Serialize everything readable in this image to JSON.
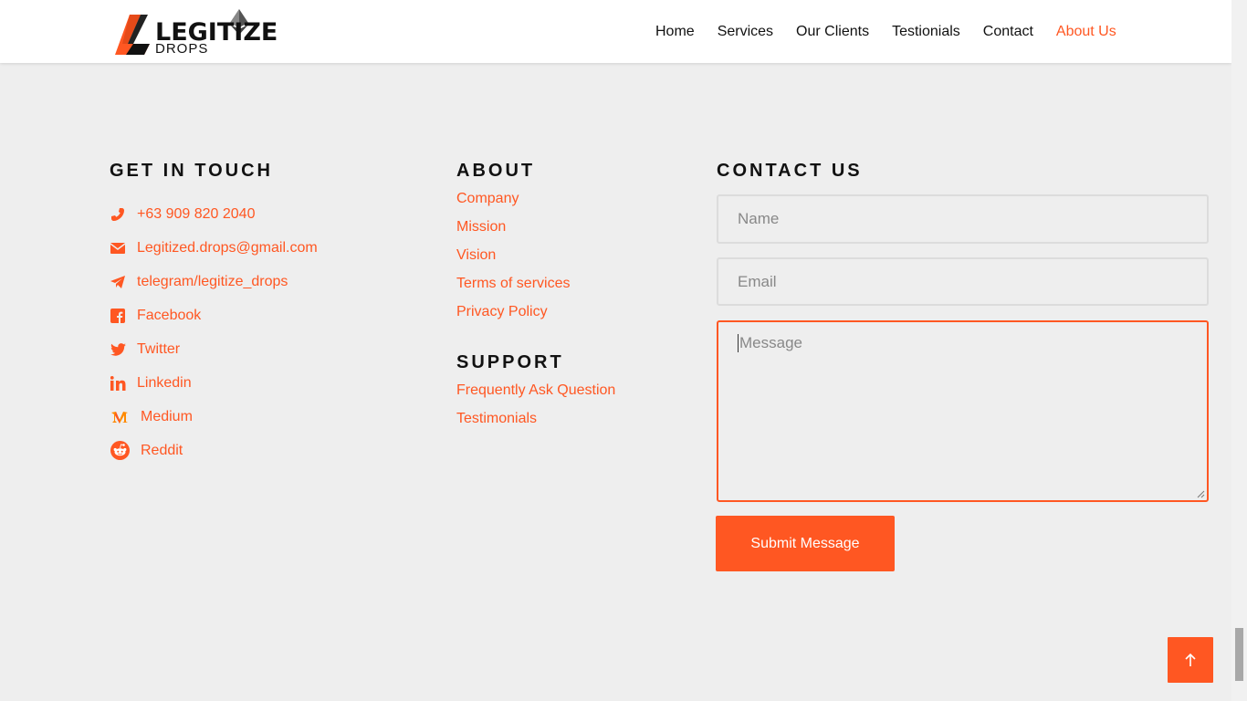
{
  "brand": {
    "word": "LEGITIZE",
    "sub": "DROPS"
  },
  "nav": {
    "items": [
      "Home",
      "Services",
      "Our Clients",
      "Testionials",
      "Contact",
      "About Us"
    ],
    "active": "About Us"
  },
  "get_in_touch": {
    "title": "GET IN TOUCH",
    "items": [
      {
        "icon": "phone-icon",
        "label": "+63 909 820 2040"
      },
      {
        "icon": "envelope-icon",
        "label": "Legitized.drops@gmail.com"
      },
      {
        "icon": "telegram-icon",
        "label": "telegram/legitize_drops"
      },
      {
        "icon": "facebook-icon",
        "label": "Facebook"
      },
      {
        "icon": "twitter-icon",
        "label": "Twitter"
      },
      {
        "icon": "linkedin-icon",
        "label": "Linkedin"
      },
      {
        "icon": "medium-icon",
        "label": "Medium"
      },
      {
        "icon": "reddit-icon",
        "label": "Reddit"
      }
    ]
  },
  "about": {
    "title": "ABOUT",
    "links": [
      "Company",
      "Mission",
      "Vision",
      "Terms of services",
      "Privacy Policy"
    ]
  },
  "support": {
    "title": "SUPPORT",
    "links": [
      "Frequently Ask Question",
      "Testimonials"
    ]
  },
  "contact_form": {
    "title": "CONTACT US",
    "name_placeholder": "Name",
    "email_placeholder": "Email",
    "message_placeholder": "Message",
    "submit_label": "Submit Message"
  },
  "colors": {
    "accent": "#ff5722",
    "background": "#eeeeee",
    "text": "#111111"
  }
}
